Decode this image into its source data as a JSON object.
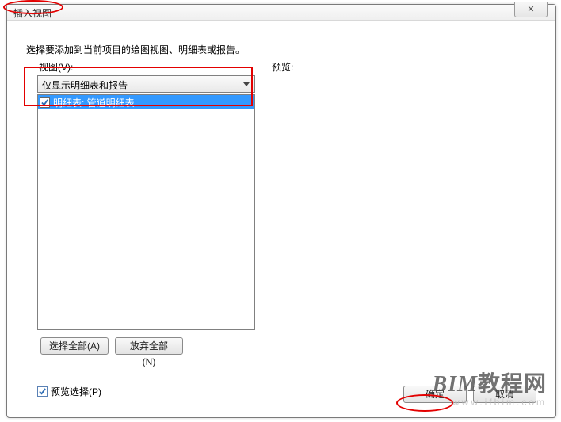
{
  "dialog": {
    "title": "插入视图",
    "instruction": "选择要添加到当前项目的绘图视图、明细表或报告。",
    "view_label": "视图(V):",
    "preview_label": "预览:",
    "dropdown_value": "仅显示明细表和报告",
    "list_items": [
      {
        "checked": true,
        "label": "明细表: 管道明细表"
      }
    ],
    "select_all": "选择全部(A)",
    "abandon_all": "放弃全部(N)",
    "preview_select": "预览选择(P)",
    "ok": "确定",
    "cancel": "取消"
  },
  "watermark": {
    "brand_latin": "BIM",
    "brand_cn": "教程网",
    "url": "www.ifbim.com"
  }
}
